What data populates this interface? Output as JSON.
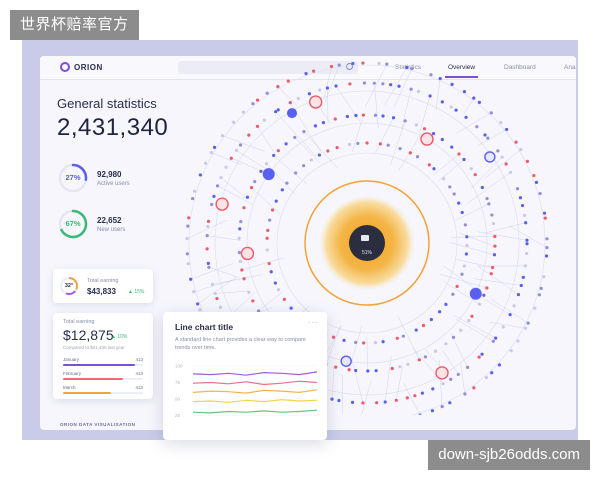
{
  "watermarks": {
    "top": "世界杯赔率官方",
    "bottom": "down-sjb26odds.com"
  },
  "nav": {
    "logo": "ORION",
    "tabs": [
      {
        "label": "Statistics",
        "active": false
      },
      {
        "label": "Overview",
        "active": true
      },
      {
        "label": "Dashboard",
        "active": false
      },
      {
        "label": "Ana",
        "active": false
      }
    ],
    "search_placeholder": ""
  },
  "stats": {
    "title": "General statistics",
    "total": "2,431,340",
    "active": {
      "pct": "27%",
      "pct_value": 0.27,
      "value": "92,980",
      "label": "Active users"
    },
    "new": {
      "pct": "67%",
      "pct_value": 0.67,
      "value": "22,652",
      "label": "New users"
    }
  },
  "earning_small": {
    "pct": "32°",
    "label": "Total earning",
    "value": "$43,833",
    "delta": "▲ 15%"
  },
  "earning_large": {
    "label": "Total earning",
    "value": "$12,875",
    "delta": "▲ 10%",
    "sub": "Compared to $21,430 last year",
    "months": [
      {
        "name": "January",
        "value": "413",
        "fill": 0.9,
        "color": "#7a52d6"
      },
      {
        "name": "February",
        "value": "413",
        "fill": 0.75,
        "color": "#ee6a7a"
      },
      {
        "name": "March",
        "value": "413",
        "fill": 0.6,
        "color": "#f2a33a"
      }
    ]
  },
  "footer": "ORION DATA VISUALISATION",
  "center_readout": "51%",
  "line_chart": {
    "title": "Line chart title",
    "menu": "···",
    "description": "A standard line chart provides a clear way to compare trends over time.",
    "yticks": [
      "100",
      "75",
      "50",
      "25"
    ],
    "series": [
      {
        "color": "#a45cdb",
        "values": [
          88,
          87,
          89,
          86,
          90,
          89,
          87,
          91
        ]
      },
      {
        "color": "#ef6f8f",
        "values": [
          74,
          75,
          73,
          76,
          72,
          74,
          77,
          75
        ]
      },
      {
        "color": "#f7b34a",
        "values": [
          60,
          62,
          61,
          59,
          63,
          62,
          60,
          64
        ]
      },
      {
        "color": "#f4d44a",
        "values": [
          46,
          47,
          45,
          48,
          46,
          49,
          47,
          48
        ]
      },
      {
        "color": "#5ec97e",
        "values": [
          30,
          29,
          31,
          30,
          32,
          30,
          31,
          33
        ]
      }
    ]
  },
  "colors": {
    "accent": "#7a52d6",
    "node_blue": "#5a5ff0",
    "node_red": "#ee5a6a",
    "orange": "#f39a1f"
  }
}
